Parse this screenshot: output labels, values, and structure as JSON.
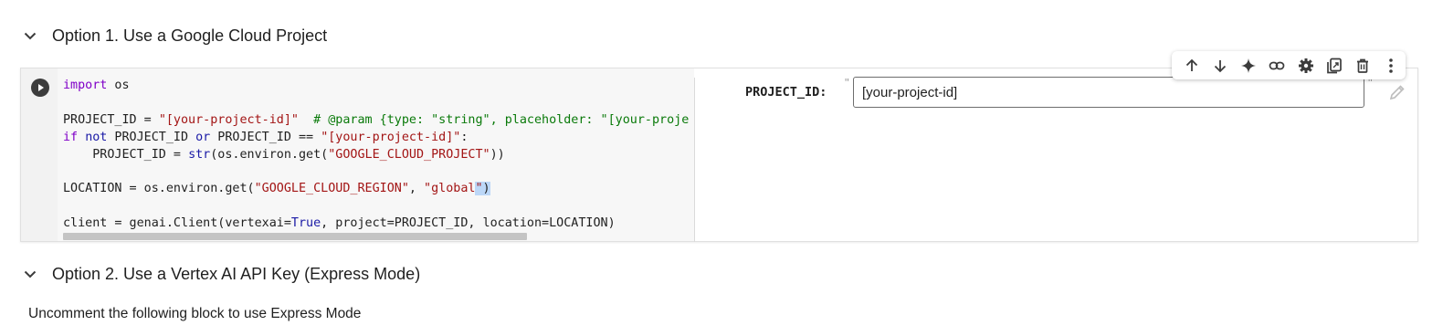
{
  "section1": {
    "title": "Option 1. Use a Google Cloud Project",
    "chevron_icon": "chevron-down-icon"
  },
  "section2": {
    "title": "Option 2. Use a Vertex AI API Key (Express Mode)",
    "chevron_icon": "chevron-down-icon"
  },
  "cell": {
    "run_icon": "play-circle-icon",
    "code": {
      "l1": {
        "kw": "import",
        "rest": " os"
      },
      "l3": {
        "a": "PROJECT_ID = ",
        "str": "\"[your-project-id]\"",
        "comment": "  # @param {type: \"string\", placeholder: \"[your-proje"
      },
      "l4": {
        "kw_if": "if",
        "kw_not": "not",
        "a": " PROJECT_ID ",
        "kw_or": "or",
        "b": " PROJECT_ID == ",
        "str": "\"[your-project-id]\"",
        "c": ":"
      },
      "l5": {
        "a": "    PROJECT_ID = ",
        "fn": "str",
        "b": "(os.environ.get(",
        "str": "\"GOOGLE_CLOUD_PROJECT\"",
        "c": "))"
      },
      "l7": {
        "a": "LOCATION = os.environ.get(",
        "str1": "\"GOOGLE_CLOUD_REGION\"",
        "b": ", ",
        "str2": "\"global",
        "str2_hl": "\"",
        "c": ")"
      },
      "l9": {
        "a": "client = genai.Client(vertexai=",
        "true": "True",
        "b": ", project=PROJECT_ID, location=LOCATION)"
      }
    },
    "form": {
      "param_label": "PROJECT_ID:",
      "value": "[your-project-id]",
      "quote_open": "\"",
      "quote_close": "\"",
      "edit_icon": "pencil-icon"
    },
    "toolbar": {
      "buttons": [
        "arrow-up-icon",
        "arrow-down-icon",
        "sparkle-icon",
        "link-icon",
        "gear-icon",
        "mirror-cell-icon",
        "trash-icon",
        "more-vert-icon"
      ]
    }
  },
  "text": {
    "express_instructions": "Uncomment the following block to use Express Mode"
  },
  "colors": {
    "keyword": "#8000c8",
    "string": "#a31515",
    "comment": "#0a7a0a",
    "builtin": "#1a1aa6"
  }
}
